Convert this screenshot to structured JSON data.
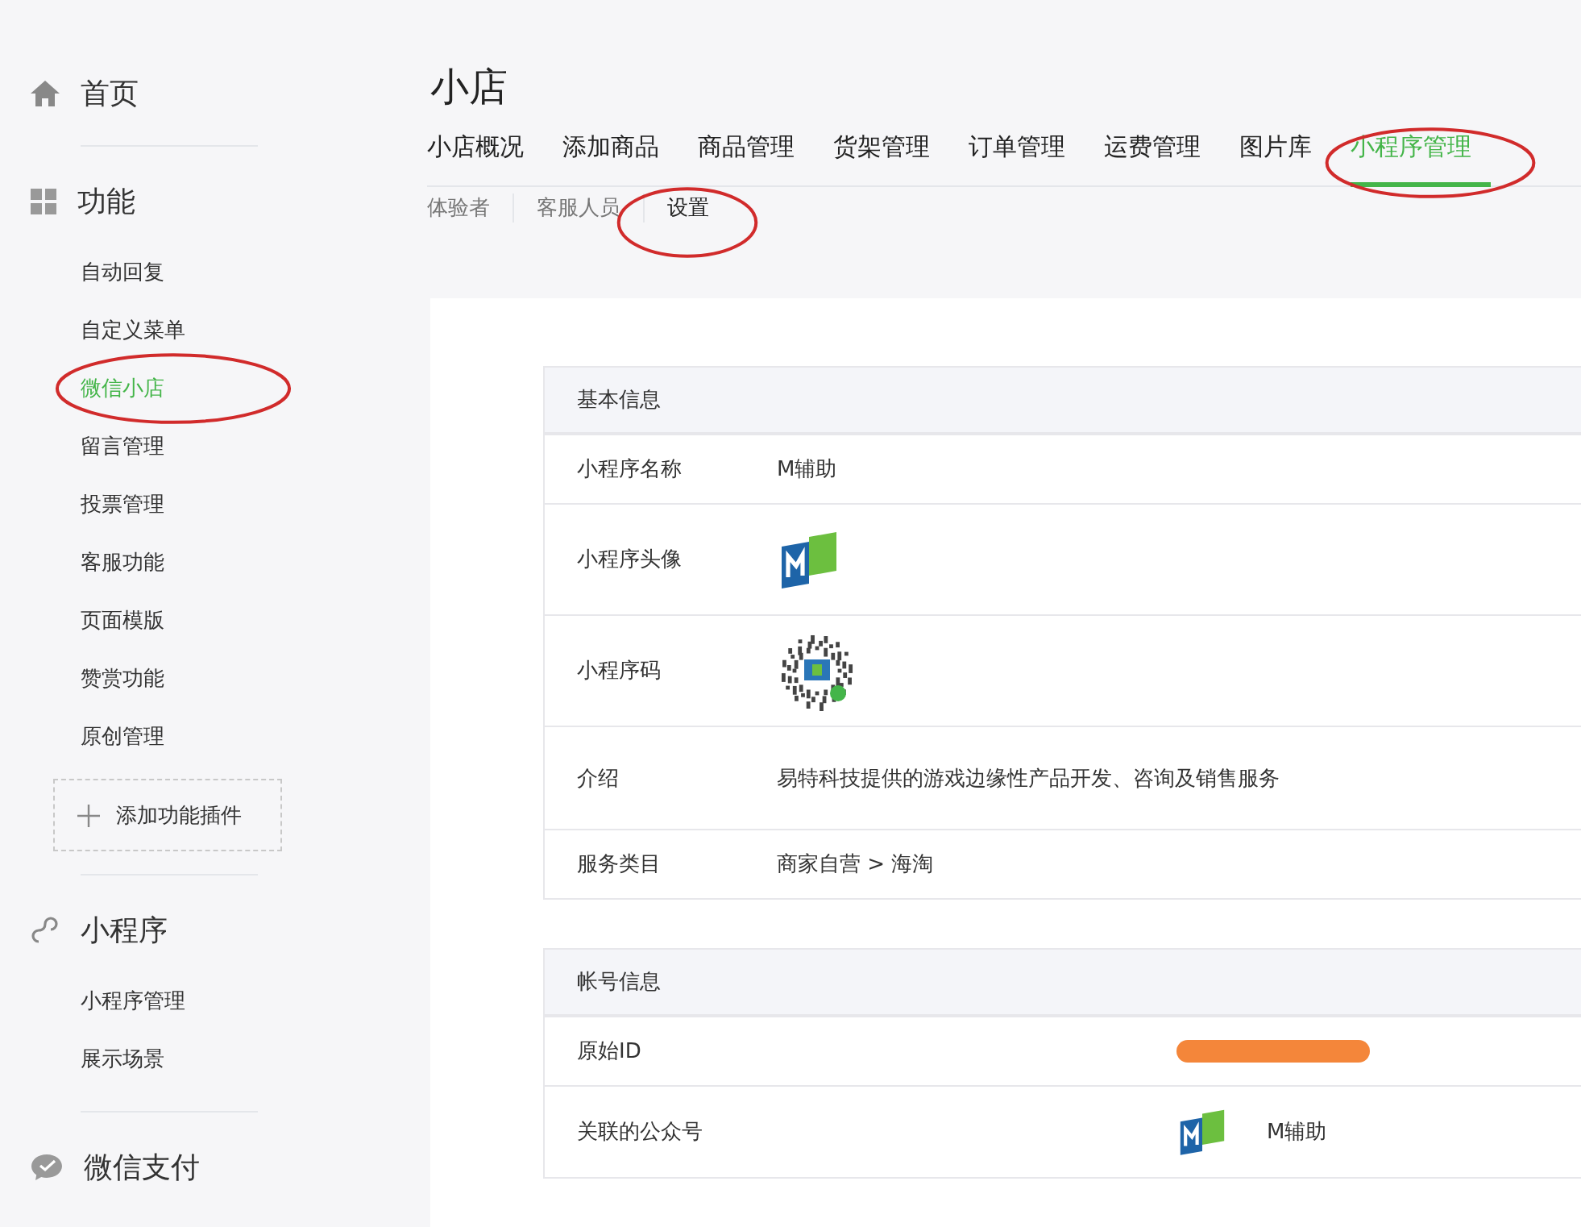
{
  "sidebar": {
    "sections": [
      {
        "kind": "home",
        "title": "首页"
      },
      {
        "kind": "grid",
        "title": "功能",
        "items": [
          {
            "label": "自动回复",
            "selected": false,
            "circled": false
          },
          {
            "label": "自定义菜单",
            "selected": false,
            "circled": false
          },
          {
            "label": "微信小店",
            "selected": true,
            "circled": true
          },
          {
            "label": "留言管理",
            "selected": false,
            "circled": false
          },
          {
            "label": "投票管理",
            "selected": false,
            "circled": false
          },
          {
            "label": "客服功能",
            "selected": false,
            "circled": false
          },
          {
            "label": "页面模版",
            "selected": false,
            "circled": false
          },
          {
            "label": "赞赏功能",
            "selected": false,
            "circled": false
          },
          {
            "label": "原创管理",
            "selected": false,
            "circled": false
          }
        ],
        "add_button": "添加功能插件"
      },
      {
        "kind": "link",
        "title": "小程序",
        "items": [
          {
            "label": "小程序管理",
            "selected": false,
            "circled": false
          },
          {
            "label": "展示场景",
            "selected": false,
            "circled": false
          }
        ]
      },
      {
        "kind": "chat",
        "title": "微信支付"
      }
    ]
  },
  "page_title": "小店",
  "tabs": [
    {
      "label": "小店概况",
      "selected": false,
      "circled": false
    },
    {
      "label": "添加商品",
      "selected": false,
      "circled": false
    },
    {
      "label": "商品管理",
      "selected": false,
      "circled": false
    },
    {
      "label": "货架管理",
      "selected": false,
      "circled": false
    },
    {
      "label": "订单管理",
      "selected": false,
      "circled": false
    },
    {
      "label": "运费管理",
      "selected": false,
      "circled": false
    },
    {
      "label": "图片库",
      "selected": false,
      "circled": false
    },
    {
      "label": "小程序管理",
      "selected": true,
      "circled": true
    }
  ],
  "subtabs": [
    {
      "label": "体验者",
      "selected": false,
      "circled": false
    },
    {
      "label": "客服人员",
      "selected": false,
      "circled": false
    },
    {
      "label": "设置",
      "selected": true,
      "circled": true
    }
  ],
  "tables": [
    {
      "title": "基本信息",
      "wide": false,
      "rows": [
        {
          "kind": "text",
          "label": "小程序名称",
          "value": "M辅助"
        },
        {
          "kind": "logo",
          "label": "小程序头像"
        },
        {
          "kind": "qrcode",
          "label": "小程序码"
        },
        {
          "kind": "text",
          "label": "介绍",
          "value": "易特科技提供的游戏边缘性产品开发、咨询及销售服务"
        },
        {
          "kind": "text",
          "label": "服务类目",
          "value": "商家自营 > 海淘"
        }
      ]
    },
    {
      "title": "帐号信息",
      "wide": true,
      "rows": [
        {
          "kind": "redacted",
          "label": "原始ID"
        },
        {
          "kind": "logo_text",
          "label": "关联的公众号",
          "value": "M辅助"
        }
      ]
    }
  ]
}
